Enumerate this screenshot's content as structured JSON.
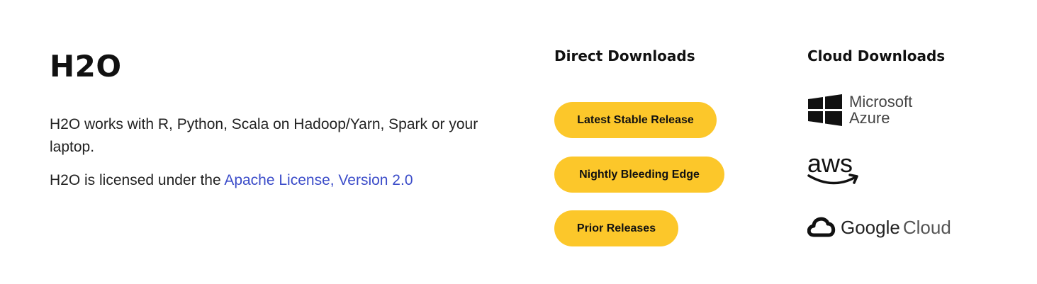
{
  "product": {
    "title": "H2O",
    "description": "H2O works with R, Python, Scala on Hadoop/Yarn, Spark or your laptop.",
    "license_prefix": "H2O is licensed under the ",
    "license_link": "Apache License, Version 2.0"
  },
  "direct_downloads": {
    "heading": "Direct Downloads",
    "buttons": [
      {
        "label": "Latest Stable Release"
      },
      {
        "label": "Nightly Bleeding Edge"
      },
      {
        "label": "Prior Releases"
      }
    ]
  },
  "cloud_downloads": {
    "heading": "Cloud Downloads",
    "providers": [
      {
        "icon": "microsoft-windows-icon",
        "line1": "Microsoft",
        "line2": "Azure"
      },
      {
        "icon": "aws-smile-icon",
        "wordmark": "aws"
      },
      {
        "icon": "google-cloud-icon",
        "word1": "Google",
        "word2": "Cloud"
      }
    ]
  },
  "colors": {
    "button": "#fcc72a",
    "link": "#3b4cc9",
    "text": "#1a1a1a"
  }
}
